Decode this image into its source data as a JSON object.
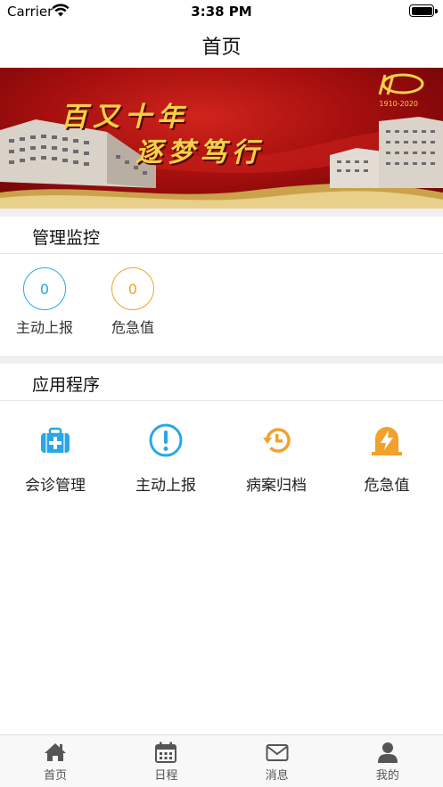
{
  "status_bar": {
    "carrier": "Carrier",
    "time": "3:38 PM"
  },
  "nav": {
    "title": "首页"
  },
  "banner": {
    "line1": "百又十年",
    "line2": "逐梦笃行",
    "years": "1910-2020"
  },
  "monitor": {
    "title": "管理监控",
    "items": [
      {
        "value": "0",
        "label": "主动上报",
        "color": "#2aa6e8"
      },
      {
        "value": "0",
        "label": "危急值",
        "color": "#f2a12b"
      }
    ]
  },
  "apps": {
    "title": "应用程序",
    "items": [
      {
        "label": "会诊管理",
        "icon": "medical-kit-icon",
        "color": "#2aa6e8"
      },
      {
        "label": "主动上报",
        "icon": "alert-circle-icon",
        "color": "#2aa6e8"
      },
      {
        "label": "病案归档",
        "icon": "history-icon",
        "color": "#f2a12b"
      },
      {
        "label": "危急值",
        "icon": "lightning-alarm-icon",
        "color": "#f2a12b"
      }
    ]
  },
  "tabs": [
    {
      "label": "首页",
      "icon": "home-icon"
    },
    {
      "label": "日程",
      "icon": "calendar-icon"
    },
    {
      "label": "消息",
      "icon": "mail-icon"
    },
    {
      "label": "我的",
      "icon": "user-icon"
    }
  ]
}
